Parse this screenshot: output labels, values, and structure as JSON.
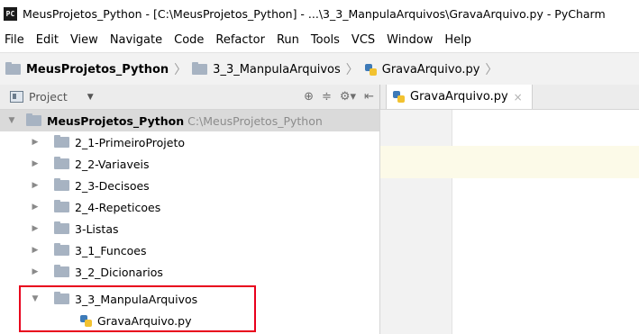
{
  "window": {
    "app_icon_text": "PC",
    "title": "MeusProjetos_Python - [C:\\MeusProjetos_Python] - ...\\3_3_ManpulaArquivos\\GravaArquivo.py - PyCharm"
  },
  "menu": [
    "File",
    "Edit",
    "View",
    "Navigate",
    "Code",
    "Refactor",
    "Run",
    "Tools",
    "VCS",
    "Window",
    "Help"
  ],
  "breadcrumb": {
    "project": "MeusProjetos_Python",
    "folder": "3_3_ManpulaArquivos",
    "file": "GravaArquivo.py"
  },
  "project_panel": {
    "label": "Project",
    "dropdown_icon": "triangle-down",
    "tool_icons": [
      "locate-icon",
      "collapse-icon",
      "settings-icon",
      "hide-icon"
    ]
  },
  "editor": {
    "tab_label": "GravaArquivo.py",
    "tab_close": "×"
  },
  "tree": {
    "root": {
      "name": "MeusProjetos_Python",
      "path": "C:\\MeusProjetos_Python"
    },
    "folders": [
      "2_1-PrimeiroProjeto",
      "2_2-Variaveis",
      "2_3-Decisoes",
      "2_4-Repeticoes",
      "3-Listas",
      "3_1_Funcoes",
      "3_2_Dicionarios",
      "3_3_ManpulaArquivos"
    ],
    "file": "GravaArquivo.py"
  },
  "colors": {
    "highlight_border": "#e8001c",
    "folder": "#a7b3c2",
    "caret_line": "#fcfae8"
  }
}
